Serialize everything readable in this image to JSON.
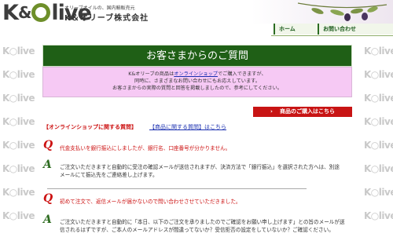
{
  "header": {
    "logo_text_k": "K",
    "logo_text_rest": "live",
    "tagline": "オリーブオイルの、国内輸販売元",
    "company": "K＆オリーブ株式会社"
  },
  "nav": {
    "home": "ホーム",
    "contact": "お問い合わせ"
  },
  "side_logo": "K○live",
  "page_title": "お客さまからのご質問",
  "intro": {
    "line1_pre": "K&オリーブの商品は",
    "line1_link": "オンラインショップ",
    "line1_post": "でご購入できますが、",
    "line2": "同時に、さまざまなお問い合わせにもお応えしています。",
    "line3": "お客さまからの実際の質問と回答を掲載しましたので、参考にしてください。"
  },
  "buy_button": {
    "arrow": "›",
    "label": "商品のご購入はこちら"
  },
  "tabs": {
    "online": "【オンラインショップに関する質問】",
    "product": "【商品に関する質問】はこちら"
  },
  "qa": [
    {
      "q_mark": "Q",
      "question": "代金支払いを銀行振込にしましたが、銀行名、口座番号が分かりません。",
      "a_mark": "A",
      "answer_line1": "ご注文いただきますと自動的に受注の確認メールが送信されますが、決済方法で「銀行振込」を選択された方へは、別途",
      "answer_line2": "メールにて振込先をご連絡差し上げます。"
    },
    {
      "q_mark": "Q",
      "question": "初めて注文で、返信メールが届かないので問い合わせさせていただきました。",
      "a_mark": "A",
      "answer_line1": "ご注文いただきますと自動的に「本日、以下のご注文を承りましたのでご確認をお願い申し上げます」との旨のメールが送",
      "answer_line2": "信されるはずですが、ご本人のメールアドレスが間違ってないか？受信拒否の設定をしていないか？ご確認ください。"
    }
  ],
  "colors": {
    "title_bar_bg": "#1f5f16",
    "intro_bg": "#f6c9f4",
    "buy_button_bg": "#c81414",
    "question_red": "#cc1111",
    "answer_green": "#2c6b1f",
    "link_blue": "#1a2fb0"
  }
}
